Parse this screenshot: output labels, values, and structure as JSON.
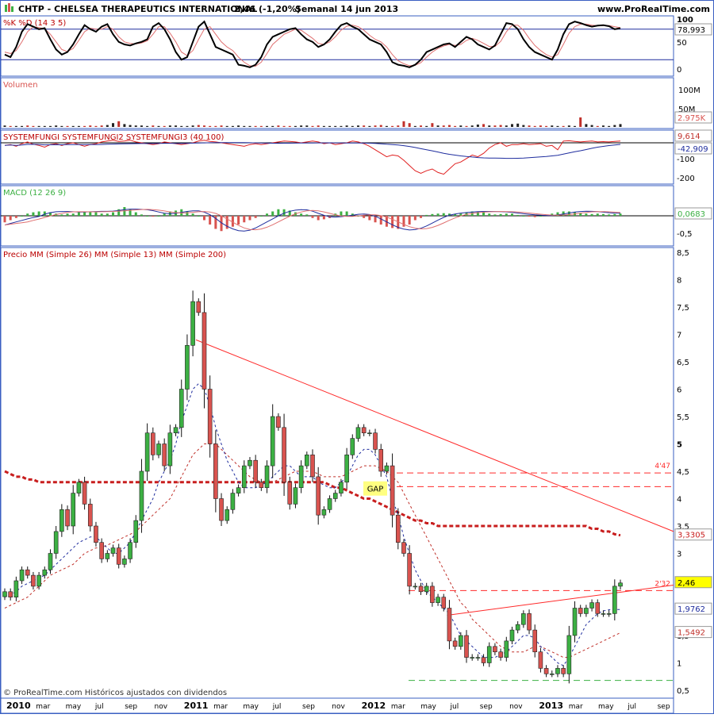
{
  "header": {
    "symbol": "CHTP - CHELSEA THERAPEUTICS INTERNATIONAL",
    "price": "2,46 (-1,20%)",
    "period": "Semanal 14 jun 2013",
    "site": "www.ProRealTime.com"
  },
  "footer": {
    "copyright": "© ProRealTime.com Históricos ajustados con dividendos"
  },
  "colors": {
    "up": "#3cb043",
    "down": "#d9534f",
    "frame": "#3a5fc2",
    "trend": "#ff2a2a",
    "ma26": "#c0302a",
    "ma13": "#1f2d9e",
    "ma200": "#c81e1e"
  },
  "chart_data": {
    "type": "candlestick",
    "x_axis_labels": [
      "2010",
      "mar",
      "may",
      "jul",
      "sep",
      "nov",
      "2011",
      "mar",
      "may",
      "jul",
      "sep",
      "nov",
      "2012",
      "mar",
      "may",
      "jul",
      "sep",
      "nov",
      "2013",
      "mar",
      "may",
      "jul",
      "sep"
    ],
    "panels": {
      "stochastic": {
        "label": "%K %D (14 3 5)",
        "ticks": [
          "100",
          "50",
          "0"
        ],
        "levels": [
          80,
          20
        ],
        "last_value": "78,993",
        "k": [
          30,
          25,
          45,
          75,
          90,
          85,
          80,
          82,
          60,
          40,
          30,
          35,
          50,
          70,
          88,
          80,
          75,
          85,
          90,
          70,
          55,
          50,
          48,
          52,
          55,
          60,
          85,
          92,
          80,
          60,
          35,
          20,
          25,
          55,
          85,
          95,
          70,
          45,
          40,
          35,
          30,
          10,
          8,
          5,
          10,
          25,
          50,
          65,
          70,
          75,
          80,
          82,
          70,
          60,
          55,
          45,
          50,
          60,
          75,
          88,
          92,
          85,
          80,
          70,
          60,
          55,
          50,
          35,
          15,
          10,
          8,
          5,
          10,
          20,
          35,
          40,
          45,
          50,
          52,
          45,
          55,
          65,
          60,
          50,
          45,
          40,
          48,
          70,
          92,
          90,
          80,
          60,
          45,
          35,
          30,
          25,
          20,
          40,
          70,
          90,
          95,
          92,
          88,
          85,
          87,
          88,
          86,
          80,
          82
        ],
        "d": [
          35,
          32,
          38,
          55,
          75,
          85,
          83,
          81,
          70,
          55,
          40,
          36,
          42,
          58,
          75,
          82,
          80,
          80,
          85,
          80,
          65,
          55,
          52,
          51,
          53,
          57,
          70,
          85,
          85,
          72,
          55,
          35,
          28,
          38,
          60,
          80,
          85,
          70,
          55,
          45,
          38,
          25,
          15,
          8,
          7,
          15,
          32,
          50,
          60,
          70,
          75,
          80,
          78,
          70,
          62,
          52,
          50,
          55,
          65,
          78,
          86,
          88,
          85,
          78,
          68,
          60,
          55,
          45,
          30,
          18,
          12,
          8,
          9,
          14,
          25,
          35,
          42,
          47,
          50,
          48,
          50,
          58,
          62,
          58,
          52,
          46,
          46,
          56,
          75,
          88,
          88,
          78,
          62,
          48,
          38,
          30,
          25,
          30,
          50,
          72,
          85,
          90,
          90,
          88,
          87,
          87,
          87,
          85,
          83
        ]
      },
      "volume": {
        "label": "Volumen",
        "ticks": [
          "100M",
          "50M"
        ],
        "last_value": "2.975K",
        "values": [
          3,
          2,
          2,
          2,
          3,
          2,
          2,
          2,
          2,
          3,
          2,
          2,
          2,
          2,
          2,
          3,
          2,
          3,
          4,
          8,
          12,
          6,
          4,
          3,
          3,
          2,
          3,
          2,
          2,
          3,
          3,
          2,
          2,
          3,
          4,
          3,
          2,
          2,
          3,
          2,
          2,
          3,
          2,
          2,
          2,
          2,
          2,
          2,
          3,
          2,
          2,
          2,
          3,
          3,
          2,
          3,
          2,
          2,
          2,
          2,
          3,
          2,
          3,
          3,
          2,
          3,
          4,
          2,
          2,
          3,
          12,
          8,
          2,
          3,
          2,
          8,
          3,
          3,
          4,
          2,
          3,
          2,
          3,
          5,
          6,
          3,
          3,
          4,
          3,
          6,
          7,
          4,
          3,
          2,
          3,
          2,
          3,
          2,
          2,
          3,
          2,
          20,
          6,
          4,
          2,
          3,
          2,
          4,
          6
        ]
      },
      "systemfungi": {
        "label": "SYSTEMFUNGI SYSTEMFUNGI2 SYSTEMFUNGI3 (40 100)",
        "ticks": [
          "-100",
          "-200"
        ],
        "last_values": [
          "9,614",
          "-42,909"
        ],
        "red": [
          -15,
          -10,
          -20,
          -5,
          5,
          -8,
          -15,
          -25,
          -10,
          -5,
          -15,
          -5,
          0,
          -10,
          -20,
          -10,
          -5,
          5,
          10,
          15,
          8,
          10,
          15,
          5,
          0,
          -5,
          -10,
          -5,
          5,
          0,
          -5,
          -10,
          -5,
          0,
          10,
          15,
          8,
          5,
          0,
          -5,
          -10,
          -15,
          -20,
          -10,
          -5,
          -10,
          -5,
          0,
          5,
          10,
          8,
          5,
          0,
          5,
          10,
          5,
          -5,
          0,
          -10,
          -5,
          0,
          10,
          5,
          -5,
          -20,
          -40,
          -60,
          -80,
          -70,
          -75,
          -100,
          -130,
          -160,
          -175,
          -160,
          -150,
          -170,
          -180,
          -150,
          -120,
          -110,
          -90,
          -70,
          -80,
          -60,
          -30,
          -10,
          0,
          -20,
          -10,
          -10,
          -5,
          -10,
          -8,
          -5,
          -20,
          -15,
          -40,
          10,
          12,
          8,
          5,
          8,
          10,
          5,
          7,
          5,
          8,
          10
        ]
      },
      "macd": {
        "label": "MACD (12 26 9)",
        "ticks": [
          "-0,5"
        ],
        "last_value": "0,0683",
        "hist": [
          -0.15,
          -0.1,
          -0.05,
          0,
          0.05,
          0.08,
          0.1,
          0.1,
          0.08,
          0.05,
          0.03,
          0.05,
          0.05,
          0.08,
          0.1,
          0.1,
          0.08,
          0.05,
          0.05,
          0.08,
          0.15,
          0.2,
          0.15,
          0.08,
          0.03,
          0,
          -0.02,
          0,
          0.05,
          0.1,
          0.12,
          0.15,
          0.1,
          0.05,
          0,
          -0.1,
          -0.2,
          -0.3,
          -0.35,
          -0.3,
          -0.25,
          -0.2,
          -0.15,
          -0.1,
          -0.05,
          0,
          0.05,
          0.1,
          0.15,
          0.15,
          0.12,
          0.08,
          0.05,
          0.03,
          -0.05,
          -0.1,
          -0.08,
          -0.05,
          0.05,
          0.1,
          0.1,
          0.05,
          0,
          -0.05,
          -0.1,
          -0.15,
          -0.2,
          -0.25,
          -0.28,
          -0.3,
          -0.25,
          -0.2,
          -0.1,
          -0.05,
          0.02,
          0.04,
          0.05,
          0.06,
          0.05,
          0.04,
          0.05,
          0.08,
          0.1,
          0.1,
          0.08,
          0.05,
          0.03,
          0.04,
          0.05,
          0.05,
          0.02,
          0,
          -0.02,
          -0.03,
          0,
          0.02,
          0.05,
          0.08,
          0.1,
          0.1,
          0.08,
          0.06,
          0.05,
          0.04,
          0.05,
          0.04,
          0.03,
          0.04,
          0.05
        ]
      },
      "price": {
        "label": "Precio MM (Simple 26) MM (Simple 13) MM (Simple 200)",
        "ticks": [
          "8,5",
          "8",
          "7,5",
          "7",
          "6,5",
          "6",
          "5,5",
          "5",
          "4,5",
          "4",
          "3,5",
          "3",
          "2,5",
          "2",
          "1,5",
          "1",
          "0,5"
        ],
        "ylim": [
          0.5,
          8.5
        ],
        "last_price": "2,46",
        "ma13_last": "1,9762",
        "ma26_last": "1,5492",
        "ma200_last": "3,3305",
        "annotations": [
          "4'47",
          "2'32",
          "GAP"
        ],
        "resistance_levels": [
          4.47,
          4.22,
          2.32
        ],
        "support_level": 0.68,
        "close": [
          2.3,
          2.2,
          2.5,
          2.7,
          2.6,
          2.4,
          2.6,
          2.7,
          3.0,
          3.4,
          3.8,
          3.5,
          4.1,
          4.3,
          3.9,
          3.5,
          3.2,
          2.9,
          3.0,
          3.1,
          2.8,
          2.9,
          3.2,
          3.6,
          4.5,
          5.2,
          4.8,
          5.0,
          4.6,
          5.2,
          5.3,
          6.0,
          6.8,
          7.6,
          7.4,
          6.0,
          5.0,
          4.0,
          3.6,
          3.8,
          4.1,
          4.2,
          4.6,
          4.7,
          4.3,
          4.2,
          4.6,
          5.5,
          5.3,
          4.3,
          3.9,
          4.2,
          4.6,
          4.8,
          4.4,
          3.7,
          3.8,
          4.0,
          4.1,
          4.3,
          4.8,
          5.1,
          5.3,
          5.2,
          5.2,
          4.9,
          4.5,
          4.6,
          3.7,
          3.2,
          3.0,
          2.4,
          2.4,
          2.3,
          2.4,
          2.1,
          2.2,
          2.0,
          1.4,
          1.3,
          1.5,
          1.1,
          1.1,
          1.1,
          1.0,
          1.3,
          1.2,
          1.1,
          1.4,
          1.6,
          1.7,
          1.9,
          1.6,
          1.2,
          0.9,
          0.8,
          0.8,
          0.9,
          0.8,
          1.5,
          2.0,
          1.9,
          2.0,
          2.1,
          1.9,
          1.9,
          1.9,
          2.4,
          2.46
        ],
        "ma13": [
          2.2,
          2.25,
          2.3,
          2.4,
          2.45,
          2.5,
          2.55,
          2.6,
          2.7,
          2.8,
          2.9,
          3.0,
          3.1,
          3.2,
          3.25,
          3.3,
          3.3,
          3.2,
          3.1,
          3.0,
          3.0,
          3.1,
          3.2,
          3.4,
          3.6,
          3.8,
          4.0,
          4.3,
          4.5,
          4.7,
          5.0,
          5.4,
          5.7,
          6.0,
          6.1,
          6.0,
          5.7,
          5.3,
          5.0,
          4.7,
          4.5,
          4.3,
          4.2,
          4.2,
          4.2,
          4.25,
          4.3,
          4.4,
          4.5,
          4.6,
          4.6,
          4.5,
          4.4,
          4.4,
          4.4,
          4.3,
          4.25,
          4.2,
          4.2,
          4.3,
          4.4,
          4.6,
          4.8,
          4.9,
          4.9,
          4.8,
          4.6,
          4.4,
          4.0,
          3.7,
          3.3,
          3.0,
          2.7,
          2.5,
          2.3,
          2.2,
          2.1,
          2.0,
          1.9,
          1.7,
          1.5,
          1.4,
          1.3,
          1.2,
          1.1,
          1.1,
          1.1,
          1.15,
          1.2,
          1.3,
          1.4,
          1.5,
          1.5,
          1.45,
          1.3,
          1.2,
          1.1,
          1.0,
          0.95,
          1.1,
          1.3,
          1.5,
          1.7,
          1.8,
          1.9,
          1.95,
          1.97,
          1.975,
          1.976
        ],
        "ma26": [
          2.0,
          2.05,
          2.1,
          2.15,
          2.2,
          2.3,
          2.4,
          2.5,
          2.6,
          2.65,
          2.7,
          2.75,
          2.8,
          2.9,
          3.0,
          3.05,
          3.1,
          3.1,
          3.15,
          3.2,
          3.25,
          3.3,
          3.35,
          3.4,
          3.5,
          3.6,
          3.7,
          3.8,
          3.9,
          4.0,
          4.2,
          4.4,
          4.6,
          4.8,
          4.9,
          5.0,
          5.0,
          5.0,
          4.9,
          4.8,
          4.7,
          4.6,
          4.5,
          4.4,
          4.35,
          4.3,
          4.3,
          4.3,
          4.35,
          4.4,
          4.45,
          4.5,
          4.5,
          4.5,
          4.5,
          4.45,
          4.4,
          4.4,
          4.4,
          4.4,
          4.45,
          4.5,
          4.55,
          4.6,
          4.6,
          4.6,
          4.55,
          4.5,
          4.4,
          4.3,
          4.1,
          3.9,
          3.7,
          3.5,
          3.3,
          3.1,
          2.9,
          2.7,
          2.5,
          2.3,
          2.1,
          2.0,
          1.8,
          1.7,
          1.6,
          1.5,
          1.4,
          1.3,
          1.25,
          1.2,
          1.2,
          1.2,
          1.25,
          1.3,
          1.3,
          1.25,
          1.2,
          1.15,
          1.1,
          1.1,
          1.15,
          1.2,
          1.25,
          1.3,
          1.35,
          1.4,
          1.45,
          1.5,
          1.55
        ],
        "ma200": [
          4.5,
          4.45,
          4.4,
          4.4,
          4.35,
          4.35,
          4.3,
          4.3,
          4.3,
          4.3,
          4.3,
          4.3,
          4.3,
          4.3,
          4.3,
          4.3,
          4.3,
          4.3,
          4.3,
          4.3,
          4.3,
          4.3,
          4.3,
          4.3,
          4.3,
          4.3,
          4.3,
          4.3,
          4.3,
          4.3,
          4.3,
          4.3,
          4.3,
          4.3,
          4.3,
          4.3,
          4.3,
          4.3,
          4.3,
          4.3,
          4.3,
          4.3,
          4.3,
          4.3,
          4.3,
          4.3,
          4.3,
          4.3,
          4.3,
          4.3,
          4.3,
          4.3,
          4.3,
          4.3,
          4.3,
          4.3,
          4.3,
          4.25,
          4.2,
          4.2,
          4.15,
          4.1,
          4.05,
          4.0,
          4.0,
          3.95,
          3.9,
          3.85,
          3.8,
          3.75,
          3.7,
          3.65,
          3.6,
          3.6,
          3.55,
          3.55,
          3.5,
          3.5,
          3.5,
          3.5,
          3.5,
          3.5,
          3.5,
          3.5,
          3.5,
          3.5,
          3.5,
          3.5,
          3.5,
          3.5,
          3.5,
          3.5,
          3.5,
          3.5,
          3.5,
          3.5,
          3.5,
          3.5,
          3.5,
          3.5,
          3.5,
          3.5,
          3.5,
          3.45,
          3.45,
          3.4,
          3.4,
          3.35,
          3.33
        ]
      }
    }
  }
}
